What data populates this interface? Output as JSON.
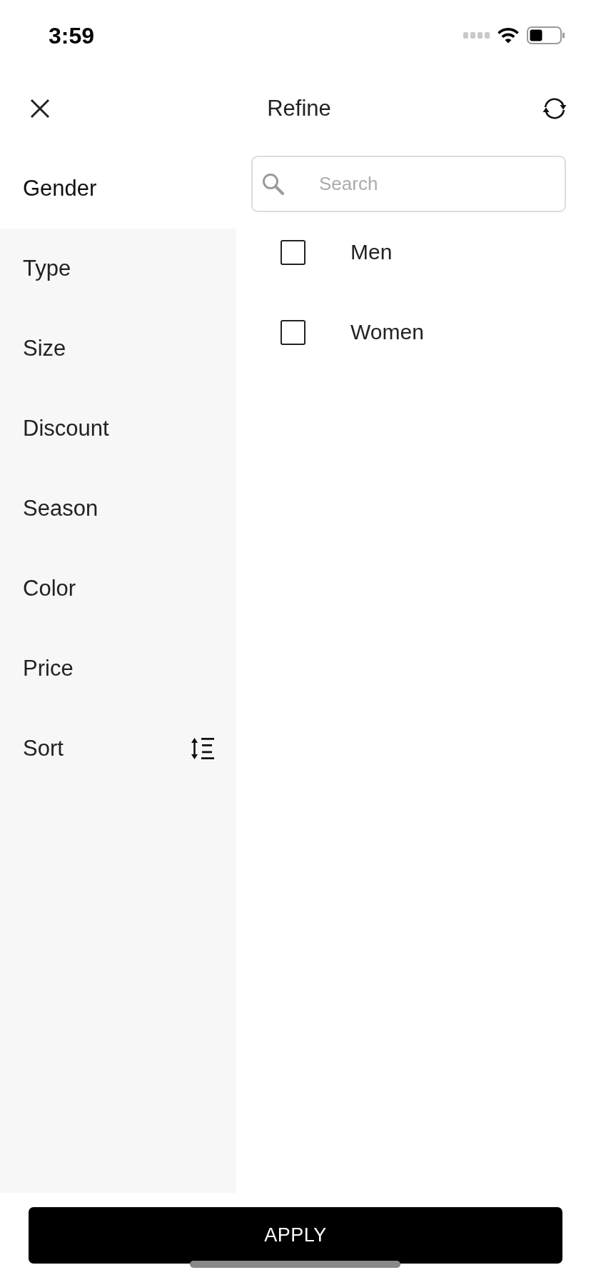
{
  "status_bar": {
    "time": "3:59"
  },
  "header": {
    "title": "Refine"
  },
  "sidebar": {
    "items": [
      {
        "label": "Gender",
        "selected": true,
        "kind": "filter"
      },
      {
        "label": "Type",
        "selected": false,
        "kind": "filter"
      },
      {
        "label": "Size",
        "selected": false,
        "kind": "filter"
      },
      {
        "label": "Discount",
        "selected": false,
        "kind": "filter"
      },
      {
        "label": "Season",
        "selected": false,
        "kind": "filter"
      },
      {
        "label": "Color",
        "selected": false,
        "kind": "filter"
      },
      {
        "label": "Price",
        "selected": false,
        "kind": "filter"
      },
      {
        "label": "Sort",
        "selected": false,
        "kind": "sort"
      }
    ]
  },
  "search": {
    "placeholder": "Search"
  },
  "options": [
    {
      "label": "Men",
      "checked": false
    },
    {
      "label": "Women",
      "checked": false
    }
  ],
  "apply_button": {
    "label": "APPLY"
  }
}
